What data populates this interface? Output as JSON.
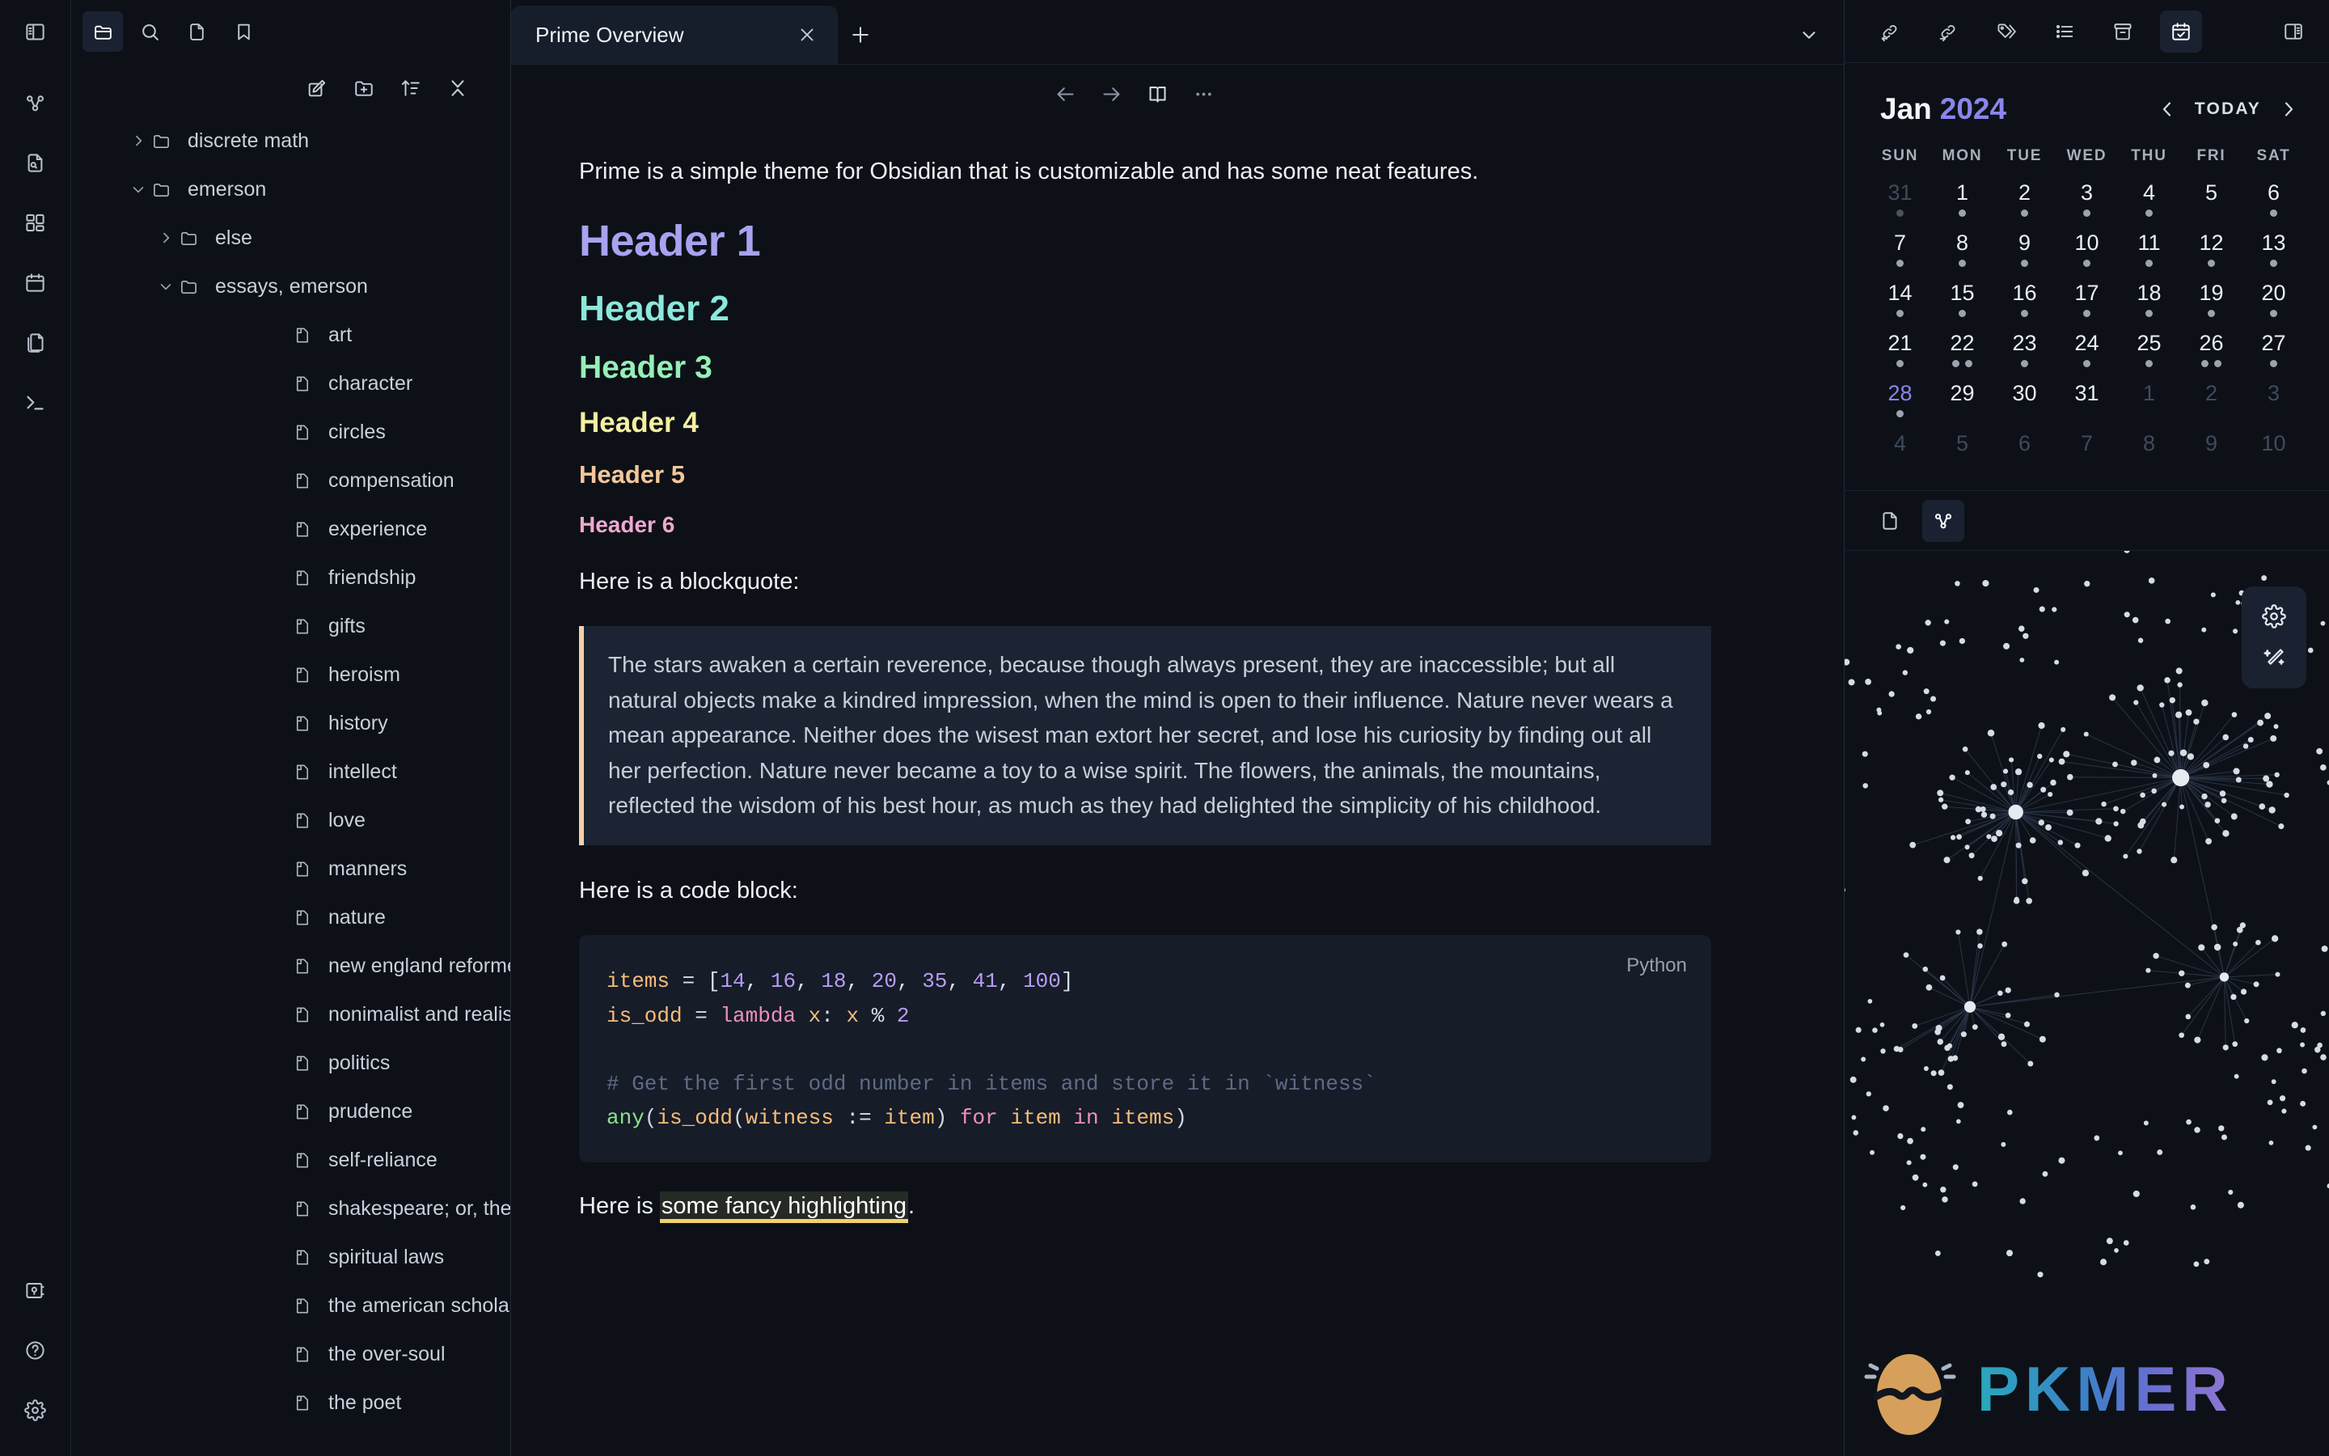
{
  "ribbon": {
    "top_icon": "sidebar-left-icon",
    "items": [
      {
        "name": "graph-view-icon",
        "label": "Open graph view"
      },
      {
        "name": "search-file-icon",
        "label": "Search in file"
      },
      {
        "name": "dashboard-icon",
        "label": "Dashboard"
      },
      {
        "name": "calendar-icon",
        "label": "Calendar"
      },
      {
        "name": "copy-files-icon",
        "label": "Copy files"
      },
      {
        "name": "terminal-icon",
        "label": "Terminal"
      }
    ],
    "bottom_items": [
      {
        "name": "vault-icon",
        "label": "Open another vault"
      },
      {
        "name": "help-icon",
        "label": "Help"
      },
      {
        "name": "settings-icon",
        "label": "Settings"
      }
    ]
  },
  "explorer": {
    "tabs": [
      {
        "name": "files-icon",
        "label": "Files",
        "active": true
      },
      {
        "name": "search-icon",
        "label": "Search",
        "active": false
      },
      {
        "name": "file-icon",
        "label": "Quick switcher",
        "active": false
      },
      {
        "name": "bookmark-icon",
        "label": "Bookmarks",
        "active": false
      }
    ],
    "actions": [
      {
        "name": "new-note-icon",
        "label": "New note"
      },
      {
        "name": "new-folder-icon",
        "label": "New folder"
      },
      {
        "name": "sort-icon",
        "label": "Change sort order"
      },
      {
        "name": "collapse-all-icon",
        "label": "Collapse all"
      }
    ],
    "tree": [
      {
        "label": "discrete math",
        "type": "folder",
        "level": 0,
        "expanded": false
      },
      {
        "label": "emerson",
        "type": "folder",
        "level": 0,
        "expanded": true
      },
      {
        "label": "else",
        "type": "folder",
        "level": 1,
        "expanded": false
      },
      {
        "label": "essays, emerson",
        "type": "folder",
        "level": 1,
        "expanded": true
      },
      {
        "label": "art",
        "type": "file",
        "level": 2
      },
      {
        "label": "character",
        "type": "file",
        "level": 2
      },
      {
        "label": "circles",
        "type": "file",
        "level": 2
      },
      {
        "label": "compensation",
        "type": "file",
        "level": 2
      },
      {
        "label": "experience",
        "type": "file",
        "level": 2
      },
      {
        "label": "friendship",
        "type": "file",
        "level": 2
      },
      {
        "label": "gifts",
        "type": "file",
        "level": 2
      },
      {
        "label": "heroism",
        "type": "file",
        "level": 2
      },
      {
        "label": "history",
        "type": "file",
        "level": 2
      },
      {
        "label": "intellect",
        "type": "file",
        "level": 2
      },
      {
        "label": "love",
        "type": "file",
        "level": 2
      },
      {
        "label": "manners",
        "type": "file",
        "level": 2
      },
      {
        "label": "nature",
        "type": "file",
        "level": 2
      },
      {
        "label": "new england reformers",
        "type": "file",
        "level": 2
      },
      {
        "label": "nonimalist and realist",
        "type": "file",
        "level": 2
      },
      {
        "label": "politics",
        "type": "file",
        "level": 2
      },
      {
        "label": "prudence",
        "type": "file",
        "level": 2
      },
      {
        "label": "self-reliance",
        "type": "file",
        "level": 2
      },
      {
        "label": "shakespeare; or, the poet",
        "type": "file",
        "level": 2
      },
      {
        "label": "spiritual laws",
        "type": "file",
        "level": 2
      },
      {
        "label": "the american scholar",
        "type": "file",
        "level": 2
      },
      {
        "label": "the over-soul",
        "type": "file",
        "level": 2
      },
      {
        "label": "the poet",
        "type": "file",
        "level": 2
      }
    ]
  },
  "editor": {
    "tab": {
      "title": "Prime Overview",
      "close_icon": "close-icon"
    },
    "new_tab_icon": "plus-icon",
    "tab_list_icon": "chevron-down-icon",
    "header_actions": [
      {
        "name": "back-icon",
        "label": "Navigate back"
      },
      {
        "name": "forward-icon",
        "label": "Navigate forward"
      },
      {
        "name": "reading-view-icon",
        "label": "Current view: reading"
      },
      {
        "name": "more-options-icon",
        "label": "More options"
      }
    ],
    "intro": "Prime is a simple theme for Obsidian that is customizable and has some neat features.",
    "headers": [
      {
        "level": 1,
        "text": "Header 1",
        "color": "#a8a2f0"
      },
      {
        "level": 2,
        "text": "Header 2",
        "color": "#8ce8dc"
      },
      {
        "level": 3,
        "text": "Header 3",
        "color": "#96efb8"
      },
      {
        "level": 4,
        "text": "Header 4",
        "color": "#f5efa0"
      },
      {
        "level": 5,
        "text": "Header 5",
        "color": "#f3c79b"
      },
      {
        "level": 6,
        "text": "Header 6",
        "color": "#f0a8d0"
      }
    ],
    "blockquote_intro": "Here is a blockquote:",
    "blockquote_text": "The stars awaken a certain reverence, because though always present, they are inaccessible; but all natural objects make a kindred impression, when the mind is open to their influence. Nature never wears a mean appearance. Neither does the wisest man extort her secret, and lose his curiosity by finding out all her perfection. Nature never became a toy to a wise spirit. The flowers, the animals, the mountains, reflected the wisdom of his best hour, as much as they had delighted the simplicity of his childhood.",
    "code_intro": "Here is a code block:",
    "code_language": "Python",
    "code_lines": {
      "l1_var": "items",
      "l1_eq": " = [",
      "l1_n1": "14",
      "l1_n2": "16",
      "l1_n3": "18",
      "l1_n4": "20",
      "l1_n5": "35",
      "l1_n6": "41",
      "l1_n7": "100",
      "l2_var": "is_odd",
      "l2_kw": "lambda",
      "l2_x": "x",
      "l2_num": "2",
      "l4_comment": "# Get the first odd number in items and store it in `witness`",
      "l5_fn": "any",
      "l5_call": "is_odd",
      "l5_witness": "witness",
      "l5_item": "item",
      "l5_for": "for",
      "l5_in": "in",
      "l5_items": "items"
    },
    "highlight_prefix": "Here is ",
    "highlight_text": "some fancy highlighting",
    "highlight_suffix": "."
  },
  "rightbar": {
    "toolbar": [
      {
        "name": "backlinks-icon",
        "label": "Backlinks",
        "active": false
      },
      {
        "name": "outgoing-links-icon",
        "label": "Outgoing links",
        "active": false
      },
      {
        "name": "tags-icon",
        "label": "Tags",
        "active": false
      },
      {
        "name": "outline-icon",
        "label": "Outline",
        "active": false
      },
      {
        "name": "archive-icon",
        "label": "Archive",
        "active": false
      },
      {
        "name": "calendar-check-icon",
        "label": "Calendar",
        "active": true
      },
      {
        "name": "sidebar-right-icon",
        "label": "Toggle right sidebar",
        "active": false
      }
    ],
    "calendar": {
      "month": "Jan",
      "year": "2024",
      "prev_icon": "chevron-left-icon",
      "next_icon": "chevron-right-icon",
      "today_label": "TODAY",
      "dow": [
        "SUN",
        "MON",
        "TUE",
        "WED",
        "THU",
        "FRI",
        "SAT"
      ],
      "weeks": [
        [
          {
            "n": "31",
            "muted": true,
            "dots": 1,
            "today": false
          },
          {
            "n": "1",
            "muted": false,
            "dots": 1,
            "today": false
          },
          {
            "n": "2",
            "muted": false,
            "dots": 1,
            "today": false
          },
          {
            "n": "3",
            "muted": false,
            "dots": 1,
            "today": false
          },
          {
            "n": "4",
            "muted": false,
            "dots": 1,
            "today": false
          },
          {
            "n": "5",
            "muted": false,
            "dots": 0,
            "today": false
          },
          {
            "n": "6",
            "muted": false,
            "dots": 1,
            "today": false
          }
        ],
        [
          {
            "n": "7",
            "muted": false,
            "dots": 1,
            "today": false
          },
          {
            "n": "8",
            "muted": false,
            "dots": 1,
            "today": false
          },
          {
            "n": "9",
            "muted": false,
            "dots": 1,
            "today": false
          },
          {
            "n": "10",
            "muted": false,
            "dots": 1,
            "today": false
          },
          {
            "n": "11",
            "muted": false,
            "dots": 1,
            "today": false
          },
          {
            "n": "12",
            "muted": false,
            "dots": 1,
            "today": false
          },
          {
            "n": "13",
            "muted": false,
            "dots": 1,
            "today": false
          }
        ],
        [
          {
            "n": "14",
            "muted": false,
            "dots": 1,
            "today": false
          },
          {
            "n": "15",
            "muted": false,
            "dots": 1,
            "today": false
          },
          {
            "n": "16",
            "muted": false,
            "dots": 1,
            "today": false
          },
          {
            "n": "17",
            "muted": false,
            "dots": 1,
            "today": false
          },
          {
            "n": "18",
            "muted": false,
            "dots": 1,
            "today": false
          },
          {
            "n": "19",
            "muted": false,
            "dots": 1,
            "today": false
          },
          {
            "n": "20",
            "muted": false,
            "dots": 1,
            "today": false
          }
        ],
        [
          {
            "n": "21",
            "muted": false,
            "dots": 1,
            "today": false
          },
          {
            "n": "22",
            "muted": false,
            "dots": 2,
            "today": false
          },
          {
            "n": "23",
            "muted": false,
            "dots": 1,
            "today": false
          },
          {
            "n": "24",
            "muted": false,
            "dots": 1,
            "today": false
          },
          {
            "n": "25",
            "muted": false,
            "dots": 1,
            "today": false
          },
          {
            "n": "26",
            "muted": false,
            "dots": 2,
            "today": false
          },
          {
            "n": "27",
            "muted": false,
            "dots": 1,
            "today": false
          }
        ],
        [
          {
            "n": "28",
            "muted": false,
            "dots": 1,
            "today": true
          },
          {
            "n": "29",
            "muted": false,
            "dots": 0,
            "today": false
          },
          {
            "n": "30",
            "muted": false,
            "dots": 0,
            "today": false
          },
          {
            "n": "31",
            "muted": false,
            "dots": 0,
            "today": false
          },
          {
            "n": "1",
            "muted": true,
            "dots": 0,
            "today": false
          },
          {
            "n": "2",
            "muted": true,
            "dots": 0,
            "today": false
          },
          {
            "n": "3",
            "muted": true,
            "dots": 0,
            "today": false
          }
        ],
        [
          {
            "n": "4",
            "muted": true,
            "dots": 0,
            "today": false
          },
          {
            "n": "5",
            "muted": true,
            "dots": 0,
            "today": false
          },
          {
            "n": "6",
            "muted": true,
            "dots": 0,
            "today": false
          },
          {
            "n": "7",
            "muted": true,
            "dots": 0,
            "today": false
          },
          {
            "n": "8",
            "muted": true,
            "dots": 0,
            "today": false
          },
          {
            "n": "9",
            "muted": true,
            "dots": 0,
            "today": false
          },
          {
            "n": "10",
            "muted": true,
            "dots": 0,
            "today": false
          }
        ]
      ]
    },
    "graph": {
      "tabs": [
        {
          "name": "local-file-icon",
          "label": "Local file",
          "active": false
        },
        {
          "name": "graph-icon",
          "label": "Graph view",
          "active": true
        }
      ],
      "tools": [
        {
          "name": "gear-icon",
          "label": "Graph settings"
        },
        {
          "name": "magic-wand-icon",
          "label": "Restore default settings"
        }
      ],
      "watermark": {
        "text": "PKMER",
        "logo": "pkmer-egg-logo"
      }
    }
  },
  "colors": {
    "accent": "#8b85ee",
    "bg": "#0d1117",
    "bg_alt": "#171e2b",
    "code_bg": "#161c28",
    "quote_bg": "#1c2333",
    "quote_border": "#f6cfa8",
    "highlight_underline": "#f2d06b"
  }
}
